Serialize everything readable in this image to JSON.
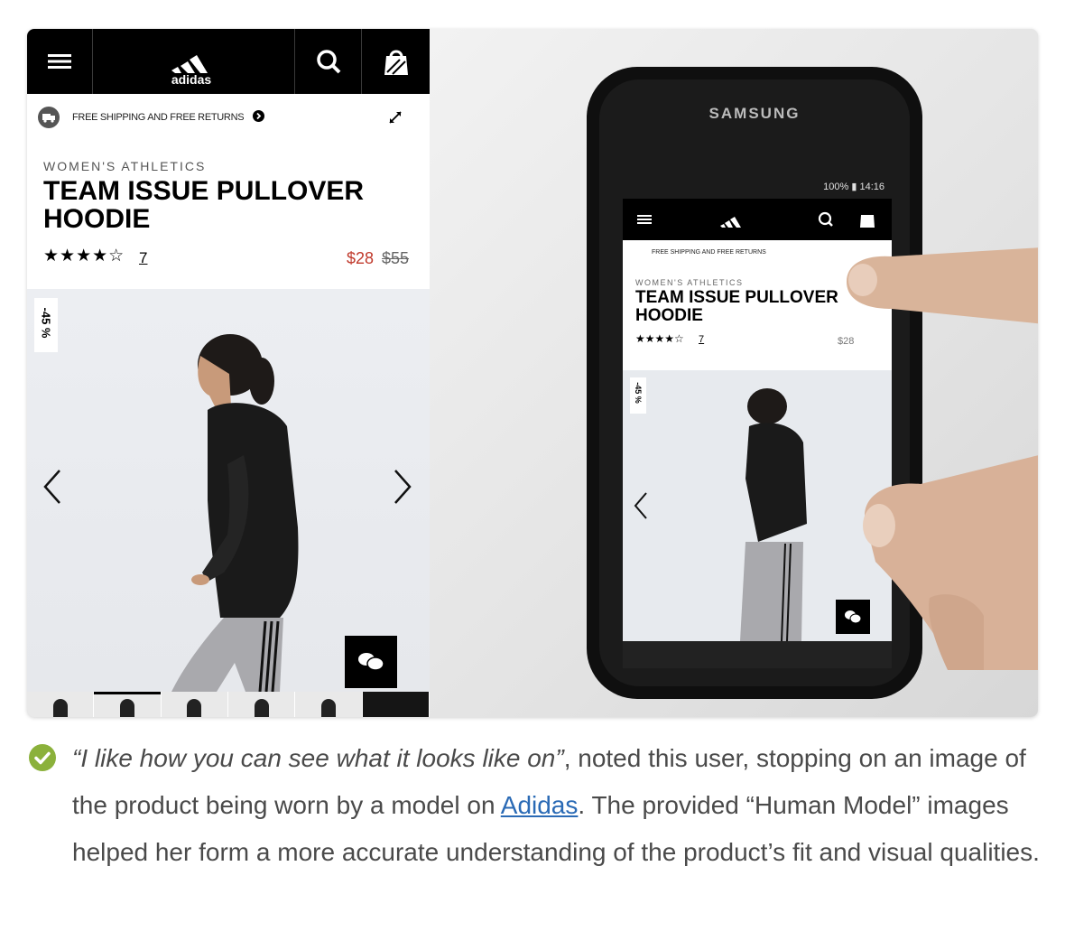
{
  "mobile_site": {
    "shipping_text": "FREE SHIPPING AND FREE RETURNS",
    "category": "WOMEN'S ATHLETICS",
    "product_title": "TEAM ISSUE PULLOVER HOODIE",
    "rating_stars": "★★★★☆",
    "review_count": "7",
    "price_sale": "$28",
    "price_original": "$55",
    "discount_badge": "-45 %",
    "brand_logo_text": "adidas"
  },
  "phone_photo": {
    "device_brand": "SAMSUNG",
    "status_bar": "100% ▮ 14:16",
    "category": "WOMEN'S ATHLETICS",
    "product_title": "TEAM ISSUE PULLOVER HOODIE",
    "rating_stars": "★★★★☆",
    "review_count": "7",
    "price": "$28",
    "discount_badge": "-45 %",
    "shipping_text": "FREE SHIPPING AND FREE RETURNS"
  },
  "caption": {
    "quote": "“I like how you can see what it looks like on”",
    "text_1": ", noted this user, stopping on an image of the product being worn by a model on ",
    "link_text": "Adidas",
    "text_2": ". The provided “Human Model” images helped her form a more accurate understanding of the product’s fit and visual qualities."
  },
  "colors": {
    "check_green": "#8bb13b",
    "sale_red": "#c0392b",
    "link_blue": "#2a6ab5"
  }
}
